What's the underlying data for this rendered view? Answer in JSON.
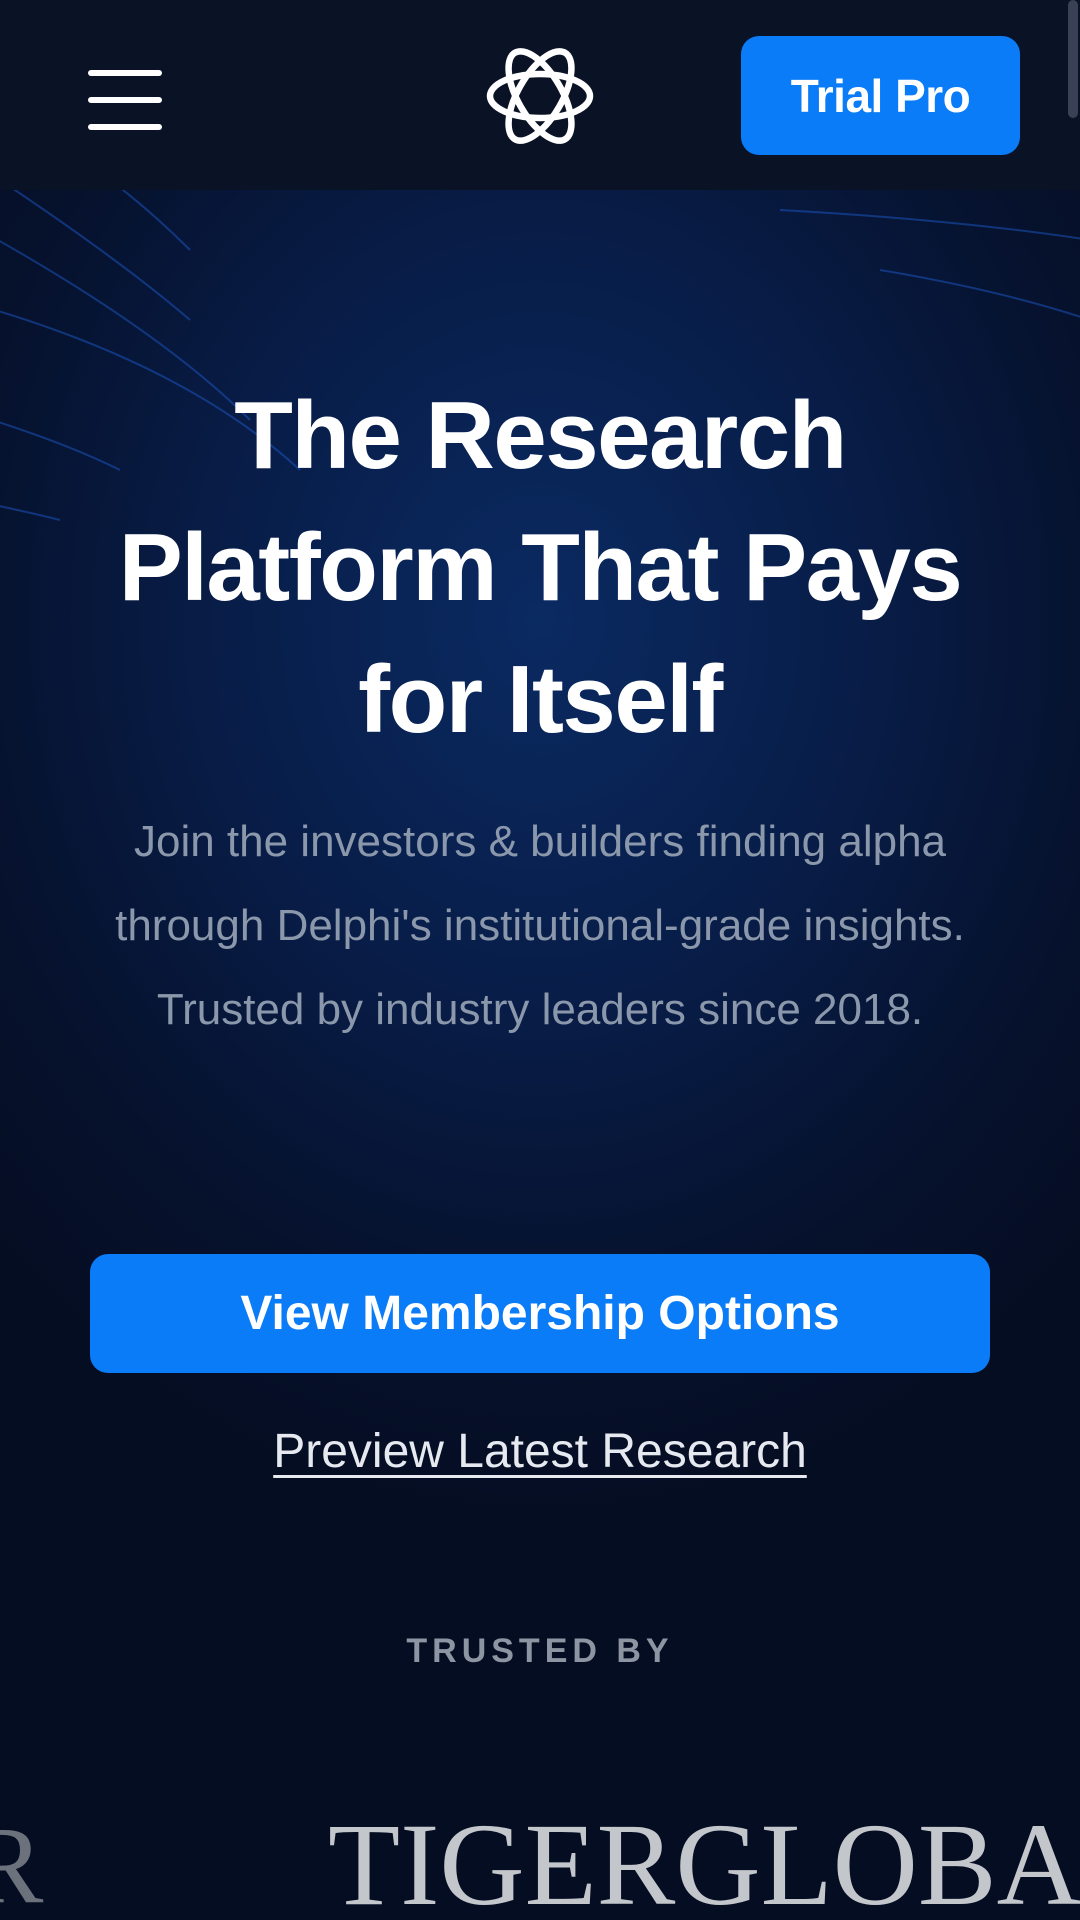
{
  "header": {
    "menu_icon": "hamburger-menu-icon",
    "logo_icon": "delphi-knot-logo-icon",
    "trial_button": "Trial Pro"
  },
  "hero": {
    "title": "The Research Platform That Pays for Itself",
    "subtitle": "Join the investors & builders finding alpha through Delphi's institutional-grade insights. Trusted by industry leaders since 2018."
  },
  "actions": {
    "primary_button": "View Membership Options",
    "secondary_link": "Preview Latest Research"
  },
  "trusted": {
    "heading": "TRUSTED BY",
    "logos": [
      "R",
      "TIGERGLOBA"
    ]
  },
  "colors": {
    "background": "#06122e",
    "header_bar": "#0a1225",
    "accent_blue": "#0a7cf7",
    "subtitle_text": "#8b97aa",
    "muted_label": "#8d95a3"
  }
}
